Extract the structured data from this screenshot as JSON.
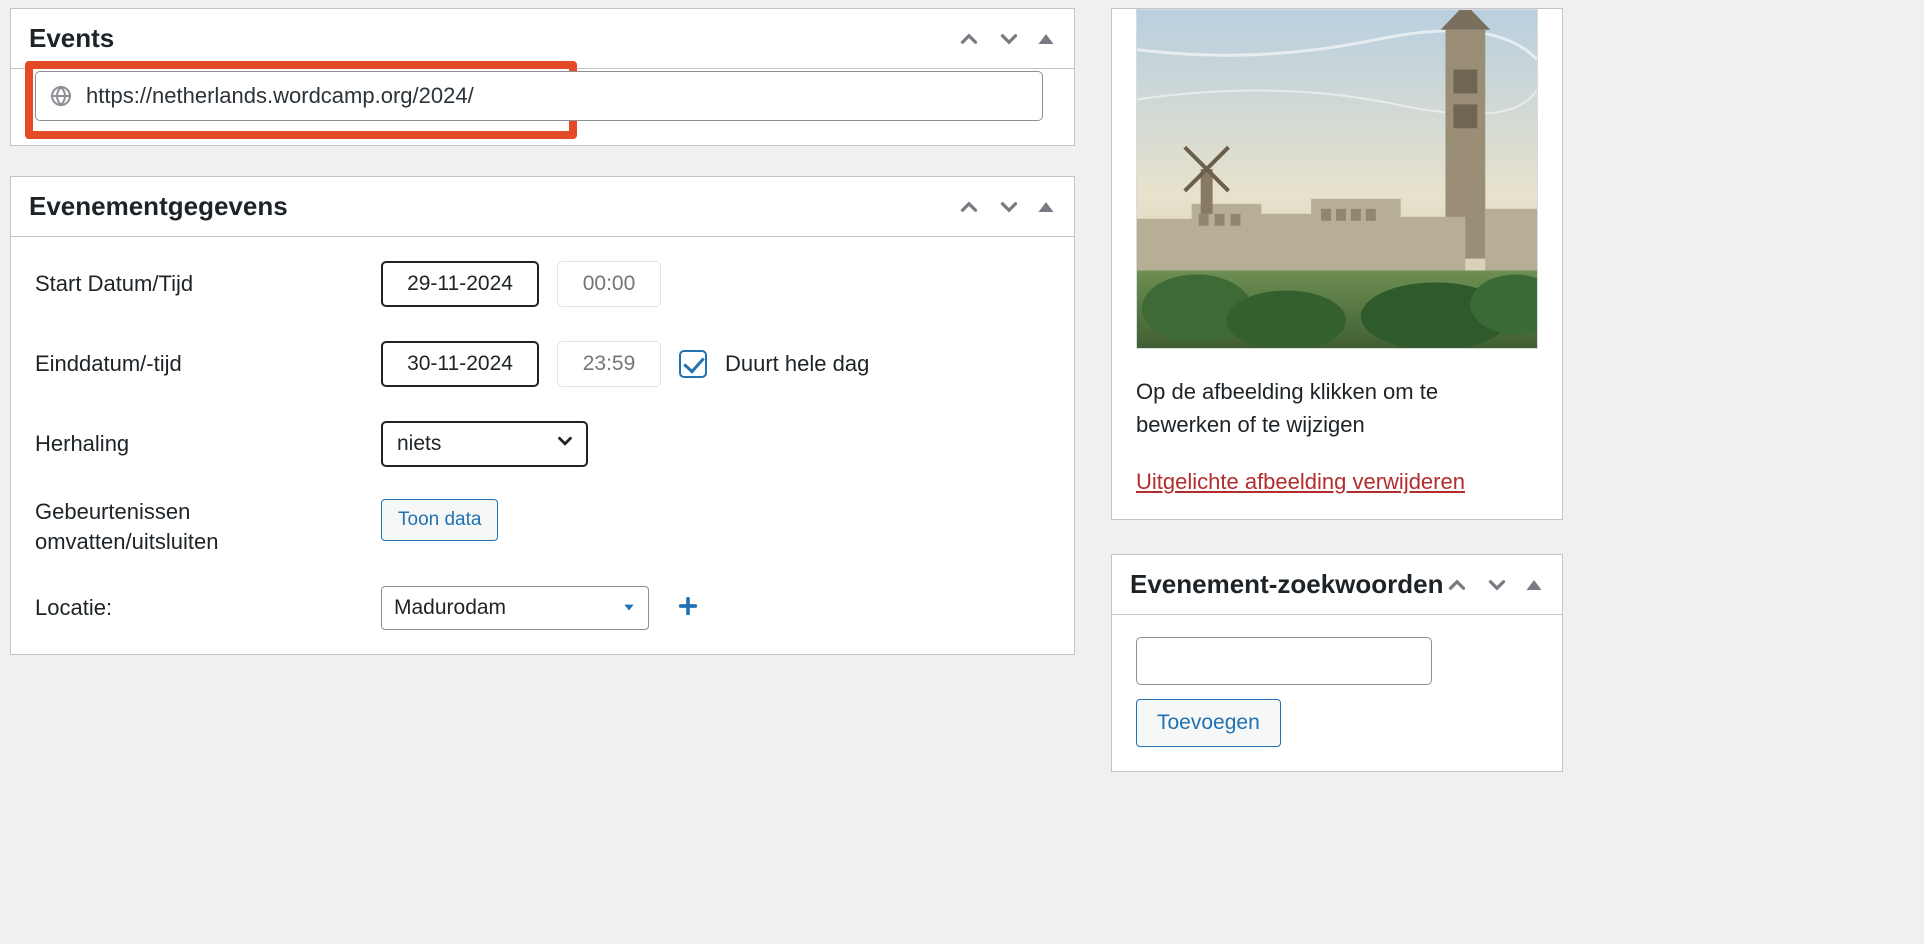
{
  "events_box": {
    "title": "Events",
    "website_label": "Website",
    "website_value": "https://netherlands.wordcamp.org/2024/"
  },
  "eventdata_box": {
    "title": "Evenementgegevens",
    "start_label": "Start Datum/Tijd",
    "start_date": "29-11-2024",
    "start_time_placeholder": "00:00",
    "end_label": "Einddatum/-tijd",
    "end_date": "30-11-2024",
    "end_time_placeholder": "23:59",
    "allday_label": "Duurt hele dag",
    "repeat_label": "Herhaling",
    "repeat_value": "niets",
    "include_label_line1": "Gebeurtenissen",
    "include_label_line2": "omvatten/uitsluiten",
    "show_data_btn": "Toon data",
    "location_label": "Locatie:",
    "location_value": "Madurodam"
  },
  "featured_image": {
    "caption": "Op de afbeelding klikken om te bewerken of te wijzigen",
    "remove_link": "Uitgelichte afbeelding verwijderen"
  },
  "keywords_box": {
    "title": "Evenement-zoekwoorden",
    "add_btn": "Toevoegen"
  }
}
